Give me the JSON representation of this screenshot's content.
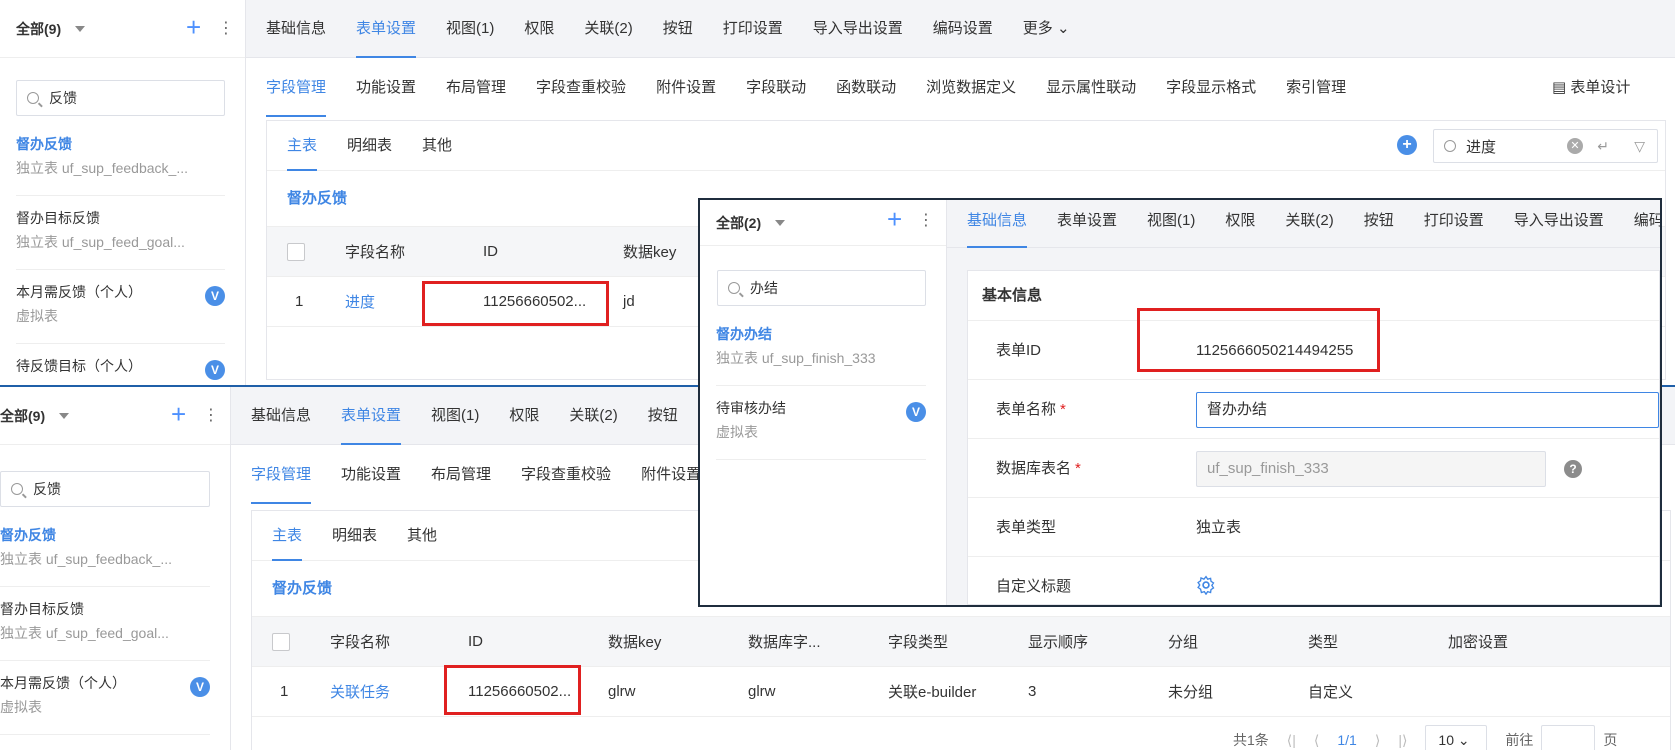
{
  "top": {
    "sidebar": {
      "title": "全部(9)",
      "search_value": "反馈",
      "items": [
        {
          "name": "督办反馈",
          "desc": "独立表 uf_sup_feedback_..."
        },
        {
          "name": "督办目标反馈",
          "desc": "独立表 uf_sup_feed_goal..."
        },
        {
          "name": "本月需反馈（个人）",
          "desc": "虚拟表",
          "badge": "V"
        },
        {
          "name": "待反馈目标（个人）",
          "badge": "V"
        }
      ]
    },
    "tabs": [
      "基础信息",
      "表单设置",
      "视图(1)",
      "权限",
      "关联(2)",
      "按钮",
      "打印设置",
      "导入导出设置",
      "编码设置",
      "更多"
    ],
    "subtabs": [
      "字段管理",
      "功能设置",
      "布局管理",
      "字段查重校验",
      "附件设置",
      "字段联动",
      "函数联动",
      "浏览数据定义",
      "显示属性联动",
      "字段显示格式",
      "索引管理"
    ],
    "form_design": "表单设计",
    "inner_tabs": [
      "主表",
      "明细表",
      "其他"
    ],
    "search_value": "进度",
    "card_title": "督办反馈",
    "columns": [
      "字段名称",
      "ID",
      "数据key"
    ],
    "row": {
      "no": "1",
      "name": "进度",
      "id": "11256660502...",
      "key": "jd"
    }
  },
  "bottom": {
    "sidebar": {
      "title": "全部(9)",
      "search_value": "反馈",
      "items": [
        {
          "name": "督办反馈",
          "desc": "独立表 uf_sup_feedback_..."
        },
        {
          "name": "督办目标反馈",
          "desc": "独立表 uf_sup_feed_goal..."
        },
        {
          "name": "本月需反馈（个人）",
          "desc": "虚拟表",
          "badge": "V"
        }
      ]
    },
    "tabs": [
      "基础信息",
      "表单设置",
      "视图(1)",
      "权限",
      "关联(2)",
      "按钮"
    ],
    "subtabs": [
      "字段管理",
      "功能设置",
      "布局管理",
      "字段查重校验",
      "附件设置"
    ],
    "inner_tabs": [
      "主表",
      "明细表",
      "其他"
    ],
    "card_title": "督办反馈",
    "columns": [
      "字段名称",
      "ID",
      "数据key",
      "数据库字...",
      "字段类型",
      "显示顺序",
      "分组",
      "类型",
      "加密设置"
    ],
    "row": {
      "no": "1",
      "name": "关联任务",
      "id": "11256660502...",
      "key": "glrw",
      "db": "glrw",
      "type": "关联e-builder",
      "order": "3",
      "group": "未分组",
      "kind": "自定义"
    },
    "pager": {
      "total": "共1条",
      "pages": "1/1",
      "size": "10",
      "goto": "前往",
      "page_unit": "页"
    }
  },
  "overlay": {
    "sidebar": {
      "title": "全部(2)",
      "search_value": "办结",
      "items": [
        {
          "name": "督办办结",
          "desc": "独立表 uf_sup_finish_333"
        },
        {
          "name": "待审核办结",
          "desc": "虚拟表",
          "badge": "V"
        }
      ]
    },
    "tabs": [
      "基础信息",
      "表单设置",
      "视图(1)",
      "权限",
      "关联(2)",
      "按钮",
      "打印设置",
      "导入导出设置",
      "编码"
    ],
    "section_title": "基本信息",
    "fields": {
      "form_id_label": "表单ID",
      "form_id_value": "1125666050214494255",
      "form_name_label": "表单名称",
      "form_name_value": "督办办结",
      "db_name_label": "数据库表名",
      "db_name_value": "uf_sup_finish_333",
      "form_type_label": "表单类型",
      "form_type_value": "独立表",
      "custom_title_label": "自定义标题"
    }
  },
  "colors": {
    "accent": "#3f86e4",
    "highlight": "#e02020"
  }
}
